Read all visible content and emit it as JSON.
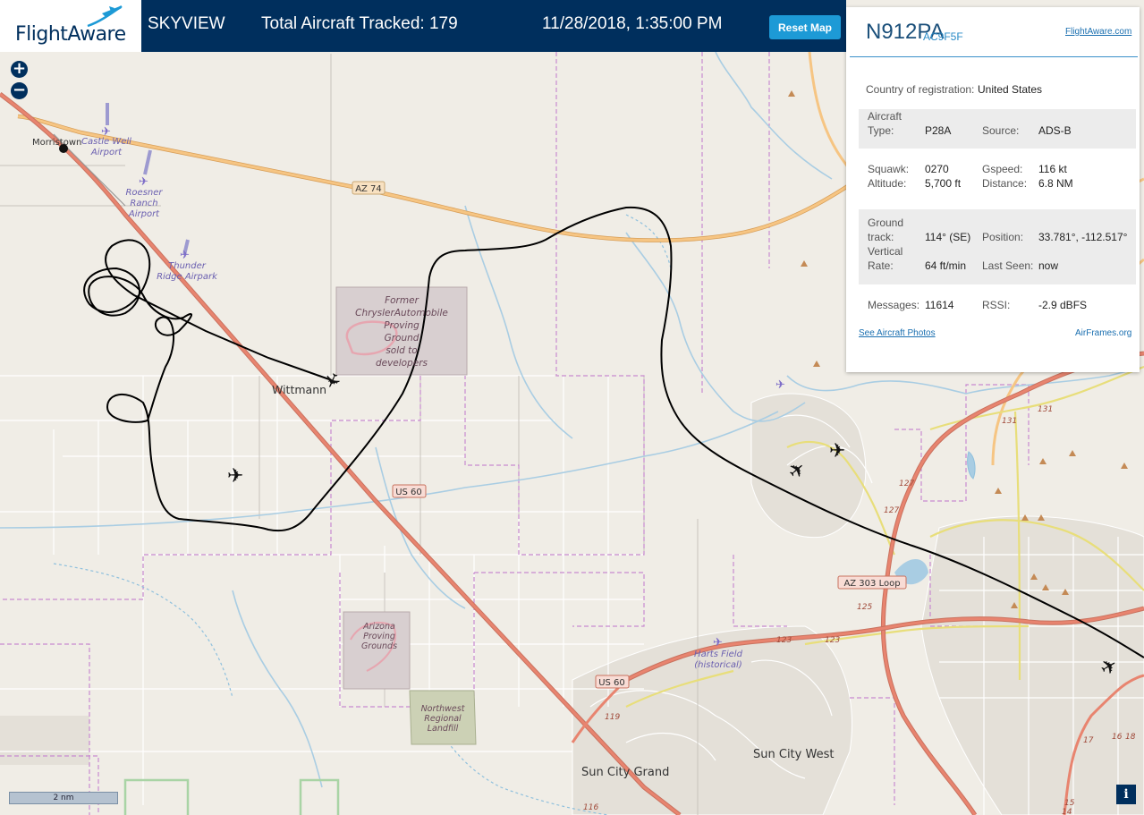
{
  "header": {
    "logo_text": "FlightAware",
    "app_name": "SKYVIEW",
    "total_tracked": "Total Aircraft Tracked: 179",
    "datetime": "11/28/2018, 1:35:00 PM",
    "reset_button": "Reset Map"
  },
  "panel": {
    "callsign": "N912PA",
    "hex": "AC9F5F",
    "flightaware_link": "FlightAware.com",
    "country_label": "Country of registration:",
    "country": "United States",
    "aircraft_type_label_1": "Aircraft",
    "aircraft_type_label_2": "Type:",
    "aircraft_type": "P28A",
    "source_label": "Source:",
    "source": "ADS-B",
    "squawk_label": "Squawk:",
    "squawk": "0270",
    "altitude_label": "Altitude:",
    "altitude": "5,700 ft",
    "gspeed_label": "Gspeed:",
    "gspeed": "116 kt",
    "distance_label": "Distance:",
    "distance": "6.8 NM",
    "ground_track_label_1": "Ground",
    "ground_track_label_2": "track:",
    "ground_track": "114° (SE)",
    "position_label": "Position:",
    "position": "33.781°, -112.517°",
    "vertical_rate_label_1": "Vertical",
    "vertical_rate_label_2": "Rate:",
    "vertical_rate": "64 ft/min",
    "last_seen_label": "Last Seen:",
    "last_seen": "now",
    "messages_label": "Messages:",
    "messages": "11614",
    "rssi_label": "RSSI:",
    "rssi": "-2.9 dBFS",
    "photos_link": "See Aircraft Photos",
    "airframes_link": "AirFrames.org"
  },
  "map": {
    "zoom_in": "+",
    "zoom_out": "−",
    "scale": "2 nm",
    "info": "i",
    "places": {
      "morristown": "Morristown",
      "wittmann": "Wittmann",
      "sun_city_grand": "Sun City Grand",
      "sun_city_west": "Sun City West"
    },
    "roads": {
      "az74": "AZ 74",
      "us60_a": "US 60",
      "us60_b": "US 60",
      "az303": "AZ 303 Loop",
      "r131a": "131",
      "r131b": "131",
      "r127a": "127",
      "r127b": "127",
      "r125": "125",
      "r123a": "123",
      "r123b": "123",
      "r119": "119",
      "r116": "116",
      "r17": "17",
      "r16": "16",
      "r18": "18",
      "r15": "15",
      "r14": "14"
    },
    "airports": {
      "castle_well_1": "Castle Well",
      "castle_well_2": "Airport",
      "roesner_1": "Roesner",
      "roesner_2": "Ranch",
      "roesner_3": "Airport",
      "thunder_1": "Thunder",
      "thunder_2": "Ridge Airpark",
      "harts_1": "Harts Field",
      "harts_2": "(historical)"
    },
    "areas": {
      "chrysler_1": "Former",
      "chrysler_2": "ChryslerAutomobile",
      "chrysler_3": "Proving",
      "chrysler_4": "Ground",
      "chrysler_5": "sold to",
      "chrysler_6": "developers",
      "arizona_1": "Arizona",
      "arizona_2": "Proving",
      "arizona_3": "Grounds",
      "landfill_1": "Northwest",
      "landfill_2": "Regional",
      "landfill_3": "Landfill"
    },
    "colors": {
      "background": "#f0ede6",
      "highway": "#e8846f",
      "state_road": "#f3b874",
      "county_boundary": "#c88ad0",
      "water": "#a9cde3",
      "flight_track": "#000000"
    }
  }
}
